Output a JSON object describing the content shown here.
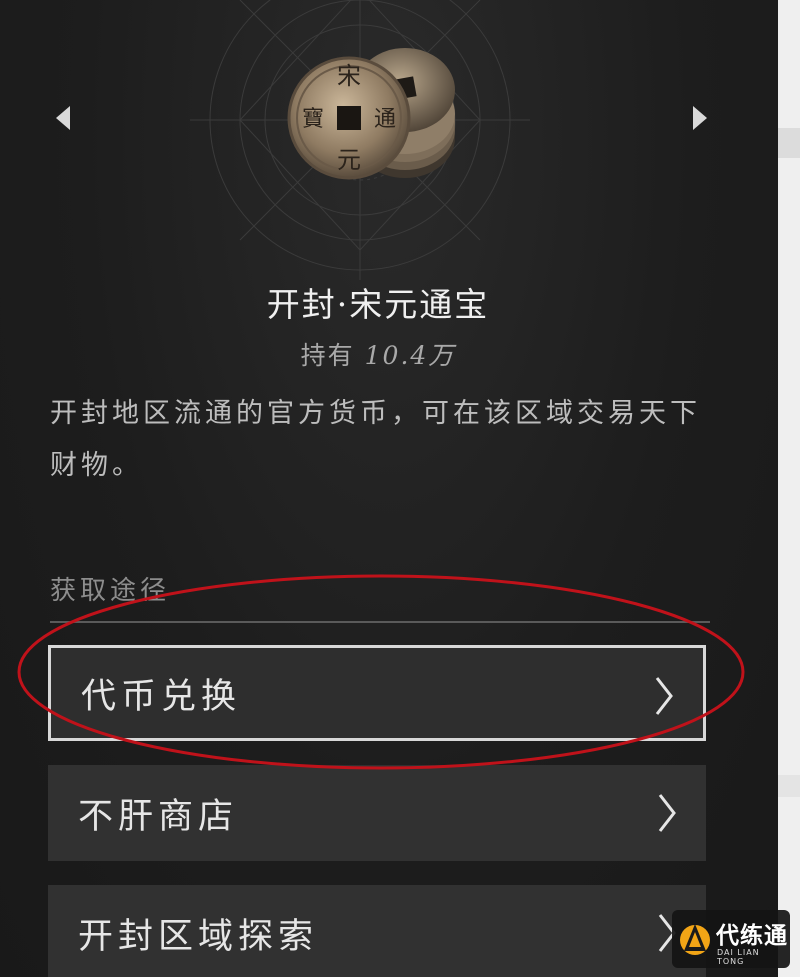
{
  "item": {
    "title": "开封·宋元通宝",
    "holding_prefix": "持有",
    "holding_amount": "10.4万",
    "description": "开封地区流通的官方货币，可在该区域交易天下财物。",
    "coin_characters": [
      "宋",
      "元",
      "通",
      "寶"
    ]
  },
  "nav": {
    "prev_icon": "triangle-left-icon",
    "next_icon": "triangle-right-icon"
  },
  "acquire": {
    "section_label": "获取途径",
    "options": [
      {
        "label": "代币兑换",
        "selected": true,
        "icon": "chevron-right-icon"
      },
      {
        "label": "不肝商店",
        "selected": false,
        "icon": "chevron-right-icon"
      },
      {
        "label": "开封区域探索",
        "selected": false,
        "icon": "chevron-right-icon"
      }
    ]
  },
  "annotation": {
    "highlight_color": "#c0121a"
  },
  "watermark": {
    "brand": "代练通",
    "brand_en": "DAI LIAN TONG"
  },
  "colors": {
    "background": "#1b1b1b",
    "button": "#313131",
    "selected_border": "#d8d8d8"
  }
}
